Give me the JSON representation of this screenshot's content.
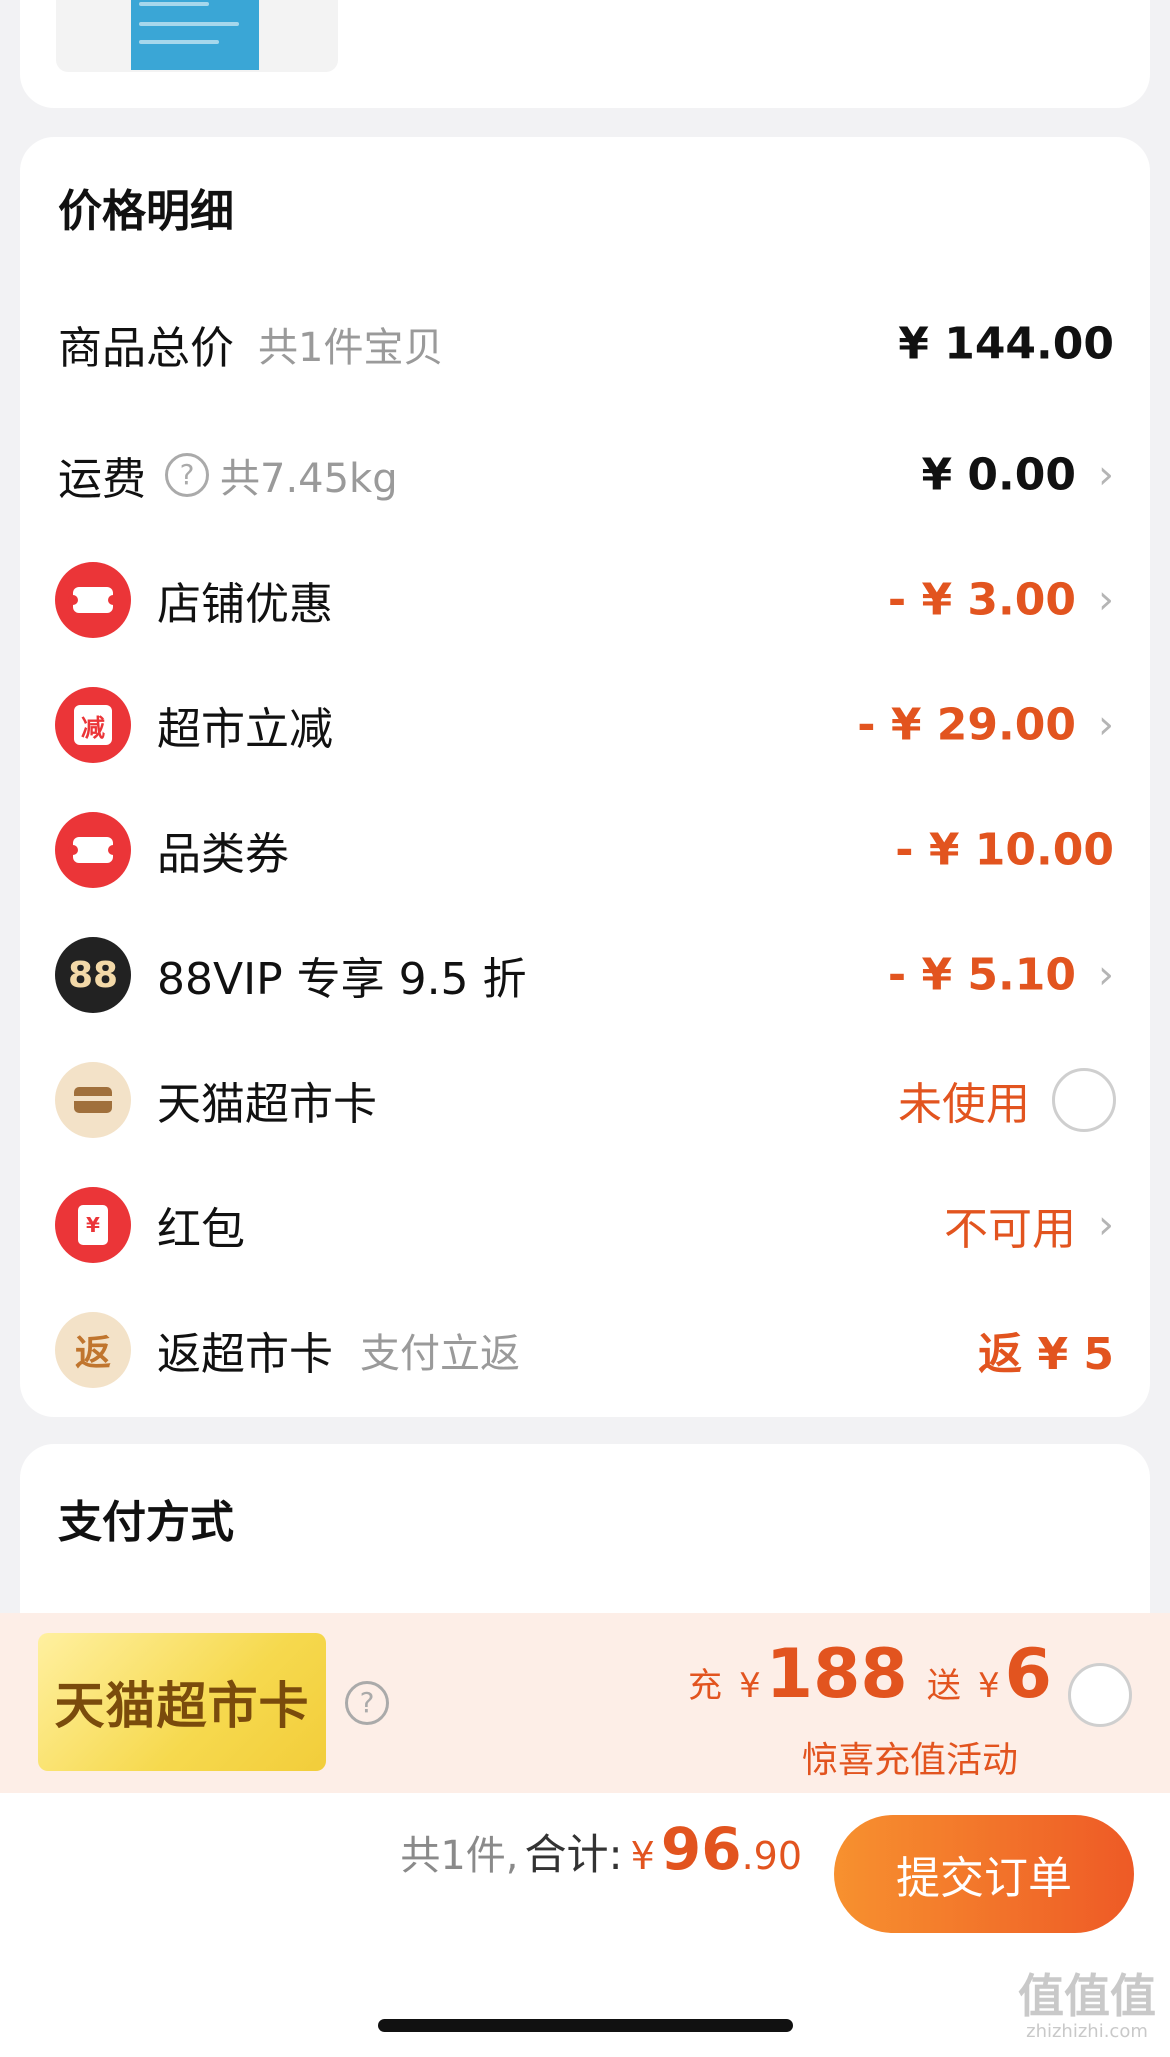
{
  "price_detail": {
    "title": "价格明细",
    "rows": [
      {
        "label": "商品总价",
        "sub": "共1件宝贝",
        "value": "¥ 144.00"
      },
      {
        "label": "运费",
        "sub": "共7.45kg",
        "value": "¥ 0.00"
      },
      {
        "label": "店铺优惠",
        "value": "- ¥ 3.00"
      },
      {
        "label": "超市立减",
        "value": "- ¥ 29.00",
        "icon_text": "减"
      },
      {
        "label": "品类券",
        "value": "- ¥ 10.00"
      },
      {
        "label": "88VIP 专享 9.5 折",
        "value": "- ¥ 5.10",
        "icon_text": "88"
      },
      {
        "label": "天猫超市卡",
        "value": "未使用"
      },
      {
        "label": "红包",
        "value": "不可用",
        "icon_text": "¥"
      },
      {
        "label": "返超市卡",
        "sub": "支付立返",
        "value": "返 ¥ 5",
        "icon_text": "返"
      }
    ]
  },
  "payment": {
    "title": "支付方式"
  },
  "promo": {
    "card_label": "天猫超市卡",
    "prefix": "充",
    "yen": "¥",
    "amount": "188",
    "gift_prefix": "送",
    "gift_amount": "6",
    "subtitle": "惊喜充值活动"
  },
  "footer": {
    "count": "共1件,",
    "sum_label": "合计:",
    "yen": "¥",
    "total_int": "96",
    "total_dec": ".90",
    "submit_label": "提交订单"
  },
  "watermark": {
    "text": "值值值",
    "url": "zhizhizhi.com"
  },
  "colors": {
    "accent": "#e2541f",
    "red_badge": "#eb3538",
    "button_start": "#f7912f",
    "button_end": "#ee5a26"
  }
}
